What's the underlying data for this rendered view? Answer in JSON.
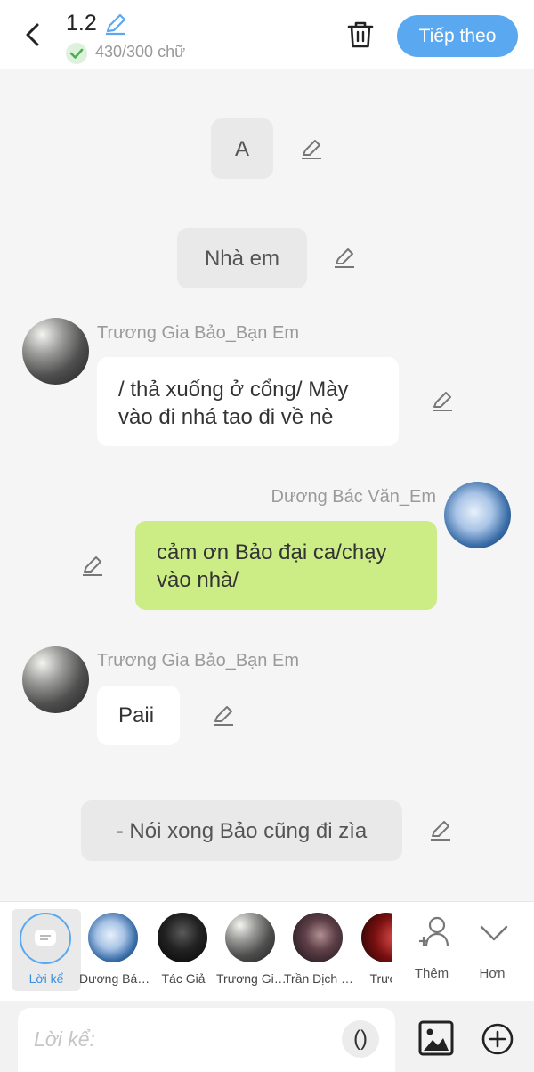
{
  "header": {
    "chapter": "1.2",
    "word_count": "430/300 chữ",
    "next_label": "Tiếp theo"
  },
  "messages": {
    "narr_a": "A",
    "narr_home": "Nhà em",
    "bao_name_1": "Trương Gia Bảo_Bạn Em",
    "bao_msg_1_line1": "/ thả xuống ở cổng/ Mày",
    "bao_msg_1_line2": "vào đi nhá tao đi về nè",
    "duong_name": "Dương Bác Văn_Em",
    "duong_msg_line1": "cảm ơn Bảo đại ca/chạy",
    "duong_msg_line2": "vào nhà/",
    "bao_name_2": "Trương Gia Bảo_Bạn Em",
    "bao_msg_2": "Paii",
    "narr_end": "- Nói xong Bảo cũng đi zìa"
  },
  "characters": [
    {
      "label": "Lời kể",
      "selected": true
    },
    {
      "label": "Dương Bá…"
    },
    {
      "label": "Tác Giả"
    },
    {
      "label": "Trương Gi…"
    },
    {
      "label": "Trần Dịch …"
    },
    {
      "label": "Trươn"
    }
  ],
  "actions": {
    "add_label": "Thêm",
    "more_label": "Hơn"
  },
  "input": {
    "placeholder": "Lời kể:",
    "paren": "()"
  },
  "colors": {
    "accent": "#5aa9f0",
    "green_bubble": "#ccec85",
    "check": "#4caf50"
  }
}
